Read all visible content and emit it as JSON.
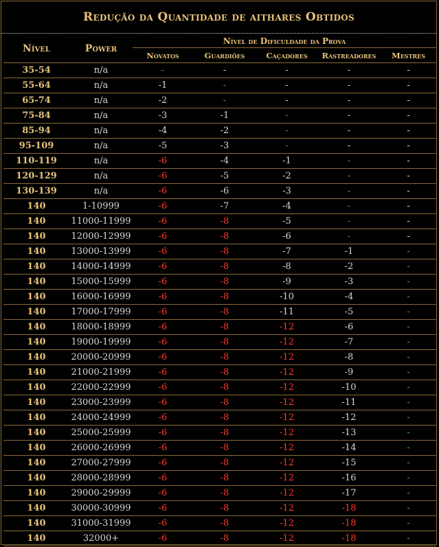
{
  "title": "Redução da Quantidade de aithares Obtidos",
  "headers": {
    "level": "Nível",
    "power": "Power",
    "difficulty": "Nível de Dificuldade da Prova",
    "columns": [
      "Novatos",
      "Guardiões",
      "Caçadores",
      "Rastreadores",
      "Mestres"
    ]
  },
  "colors": {
    "gold": "#e7c27a",
    "white": "#d8d8d8",
    "red": "#ff3a2a",
    "green": "#38b838"
  },
  "rows": [
    {
      "level": "35-54",
      "power": "n/a",
      "v": [
        [
          "-",
          "g"
        ],
        [
          "-",
          "w"
        ],
        [
          "-",
          "w"
        ],
        [
          "-",
          "w"
        ],
        [
          "-",
          "w"
        ]
      ]
    },
    {
      "level": "55-64",
      "power": "n/a",
      "v": [
        [
          "-1",
          "w"
        ],
        [
          "-",
          "g"
        ],
        [
          "-",
          "w"
        ],
        [
          "-",
          "w"
        ],
        [
          "-",
          "w"
        ]
      ]
    },
    {
      "level": "65-74",
      "power": "n/a",
      "v": [
        [
          "-2",
          "w"
        ],
        [
          "-",
          "g"
        ],
        [
          "-",
          "w"
        ],
        [
          "-",
          "w"
        ],
        [
          "-",
          "w"
        ]
      ]
    },
    {
      "level": "75-84",
      "power": "n/a",
      "v": [
        [
          "-3",
          "w"
        ],
        [
          "-1",
          "w"
        ],
        [
          "-",
          "g"
        ],
        [
          "-",
          "w"
        ],
        [
          "-",
          "w"
        ]
      ]
    },
    {
      "level": "85-94",
      "power": "n/a",
      "v": [
        [
          "-4",
          "w"
        ],
        [
          "-2",
          "w"
        ],
        [
          "-",
          "g"
        ],
        [
          "-",
          "w"
        ],
        [
          "-",
          "w"
        ]
      ]
    },
    {
      "level": "95-109",
      "power": "n/a",
      "v": [
        [
          "-5",
          "w"
        ],
        [
          "-3",
          "w"
        ],
        [
          "-",
          "g"
        ],
        [
          "-",
          "w"
        ],
        [
          "-",
          "w"
        ]
      ]
    },
    {
      "level": "110-119",
      "power": "n/a",
      "v": [
        [
          "-6",
          "r"
        ],
        [
          "-4",
          "w"
        ],
        [
          "-1",
          "w"
        ],
        [
          "-",
          "g"
        ],
        [
          "-",
          "w"
        ]
      ]
    },
    {
      "level": "120-129",
      "power": "n/a",
      "v": [
        [
          "-6",
          "r"
        ],
        [
          "-5",
          "w"
        ],
        [
          "-2",
          "w"
        ],
        [
          "-",
          "g"
        ],
        [
          "-",
          "w"
        ]
      ]
    },
    {
      "level": "130-139",
      "power": "n/a",
      "v": [
        [
          "-6",
          "r"
        ],
        [
          "-6",
          "w"
        ],
        [
          "-3",
          "w"
        ],
        [
          "-",
          "g"
        ],
        [
          "-",
          "w"
        ]
      ]
    },
    {
      "level": "140",
      "power": "1-10999",
      "v": [
        [
          "-6",
          "r"
        ],
        [
          "-7",
          "w"
        ],
        [
          "-4",
          "w"
        ],
        [
          "-",
          "g"
        ],
        [
          "-",
          "w"
        ]
      ]
    },
    {
      "level": "140",
      "power": "11000-11999",
      "v": [
        [
          "-6",
          "r"
        ],
        [
          "-8",
          "r"
        ],
        [
          "-5",
          "w"
        ],
        [
          "-",
          "g"
        ],
        [
          "-",
          "w"
        ]
      ]
    },
    {
      "level": "140",
      "power": "12000-12999",
      "v": [
        [
          "-6",
          "r"
        ],
        [
          "-8",
          "r"
        ],
        [
          "-6",
          "w"
        ],
        [
          "-",
          "g"
        ],
        [
          "-",
          "w"
        ]
      ]
    },
    {
      "level": "140",
      "power": "13000-13999",
      "v": [
        [
          "-6",
          "r"
        ],
        [
          "-8",
          "r"
        ],
        [
          "-7",
          "w"
        ],
        [
          "-1",
          "w"
        ],
        [
          "-",
          "g"
        ]
      ]
    },
    {
      "level": "140",
      "power": "14000-14999",
      "v": [
        [
          "-6",
          "r"
        ],
        [
          "-8",
          "r"
        ],
        [
          "-8",
          "w"
        ],
        [
          "-2",
          "w"
        ],
        [
          "-",
          "g"
        ]
      ]
    },
    {
      "level": "140",
      "power": "15000-15999",
      "v": [
        [
          "-6",
          "r"
        ],
        [
          "-8",
          "r"
        ],
        [
          "-9",
          "w"
        ],
        [
          "-3",
          "w"
        ],
        [
          "-",
          "g"
        ]
      ]
    },
    {
      "level": "140",
      "power": "16000-16999",
      "v": [
        [
          "-6",
          "r"
        ],
        [
          "-8",
          "r"
        ],
        [
          "-10",
          "w"
        ],
        [
          "-4",
          "w"
        ],
        [
          "-",
          "g"
        ]
      ]
    },
    {
      "level": "140",
      "power": "17000-17999",
      "v": [
        [
          "-6",
          "r"
        ],
        [
          "-8",
          "r"
        ],
        [
          "-11",
          "w"
        ],
        [
          "-5",
          "w"
        ],
        [
          "-",
          "g"
        ]
      ]
    },
    {
      "level": "140",
      "power": "18000-18999",
      "v": [
        [
          "-6",
          "r"
        ],
        [
          "-8",
          "r"
        ],
        [
          "-12",
          "r"
        ],
        [
          "-6",
          "w"
        ],
        [
          "-",
          "g"
        ]
      ]
    },
    {
      "level": "140",
      "power": "19000-19999",
      "v": [
        [
          "-6",
          "r"
        ],
        [
          "-8",
          "r"
        ],
        [
          "-12",
          "r"
        ],
        [
          "-7",
          "w"
        ],
        [
          "-",
          "g"
        ]
      ]
    },
    {
      "level": "140",
      "power": "20000-20999",
      "v": [
        [
          "-6",
          "r"
        ],
        [
          "-8",
          "r"
        ],
        [
          "-12",
          "r"
        ],
        [
          "-8",
          "w"
        ],
        [
          "-",
          "g"
        ]
      ]
    },
    {
      "level": "140",
      "power": "21000-21999",
      "v": [
        [
          "-6",
          "r"
        ],
        [
          "-8",
          "r"
        ],
        [
          "-12",
          "r"
        ],
        [
          "-9",
          "w"
        ],
        [
          "-",
          "g"
        ]
      ]
    },
    {
      "level": "140",
      "power": "22000-22999",
      "v": [
        [
          "-6",
          "r"
        ],
        [
          "-8",
          "r"
        ],
        [
          "-12",
          "r"
        ],
        [
          "-10",
          "w"
        ],
        [
          "-",
          "g"
        ]
      ]
    },
    {
      "level": "140",
      "power": "23000-23999",
      "v": [
        [
          "-6",
          "r"
        ],
        [
          "-8",
          "r"
        ],
        [
          "-12",
          "r"
        ],
        [
          "-11",
          "w"
        ],
        [
          "-",
          "g"
        ]
      ]
    },
    {
      "level": "140",
      "power": "24000-24999",
      "v": [
        [
          "-6",
          "r"
        ],
        [
          "-8",
          "r"
        ],
        [
          "-12",
          "r"
        ],
        [
          "-12",
          "w"
        ],
        [
          "-",
          "g"
        ]
      ]
    },
    {
      "level": "140",
      "power": "25000-25999",
      "v": [
        [
          "-6",
          "r"
        ],
        [
          "-8",
          "r"
        ],
        [
          "-12",
          "r"
        ],
        [
          "-13",
          "w"
        ],
        [
          "-",
          "g"
        ]
      ]
    },
    {
      "level": "140",
      "power": "26000-26999",
      "v": [
        [
          "-6",
          "r"
        ],
        [
          "-8",
          "r"
        ],
        [
          "-12",
          "r"
        ],
        [
          "-14",
          "w"
        ],
        [
          "-",
          "g"
        ]
      ]
    },
    {
      "level": "140",
      "power": "27000-27999",
      "v": [
        [
          "-6",
          "r"
        ],
        [
          "-8",
          "r"
        ],
        [
          "-12",
          "r"
        ],
        [
          "-15",
          "w"
        ],
        [
          "-",
          "g"
        ]
      ]
    },
    {
      "level": "140",
      "power": "28000-28999",
      "v": [
        [
          "-6",
          "r"
        ],
        [
          "-8",
          "r"
        ],
        [
          "-12",
          "r"
        ],
        [
          "-16",
          "w"
        ],
        [
          "-",
          "g"
        ]
      ]
    },
    {
      "level": "140",
      "power": "29000-29999",
      "v": [
        [
          "-6",
          "r"
        ],
        [
          "-8",
          "r"
        ],
        [
          "-12",
          "r"
        ],
        [
          "-17",
          "w"
        ],
        [
          "-",
          "g"
        ]
      ]
    },
    {
      "level": "140",
      "power": "30000-30999",
      "v": [
        [
          "-6",
          "r"
        ],
        [
          "-8",
          "r"
        ],
        [
          "-12",
          "r"
        ],
        [
          "-18",
          "r"
        ],
        [
          "-",
          "g"
        ]
      ]
    },
    {
      "level": "140",
      "power": "31000-31999",
      "v": [
        [
          "-6",
          "r"
        ],
        [
          "-8",
          "r"
        ],
        [
          "-12",
          "r"
        ],
        [
          "-18",
          "r"
        ],
        [
          "-",
          "g"
        ]
      ]
    },
    {
      "level": "140",
      "power": "32000+",
      "v": [
        [
          "-6",
          "r"
        ],
        [
          "-8",
          "r"
        ],
        [
          "-12",
          "r"
        ],
        [
          "-18",
          "r"
        ],
        [
          "-",
          "g"
        ]
      ]
    }
  ]
}
